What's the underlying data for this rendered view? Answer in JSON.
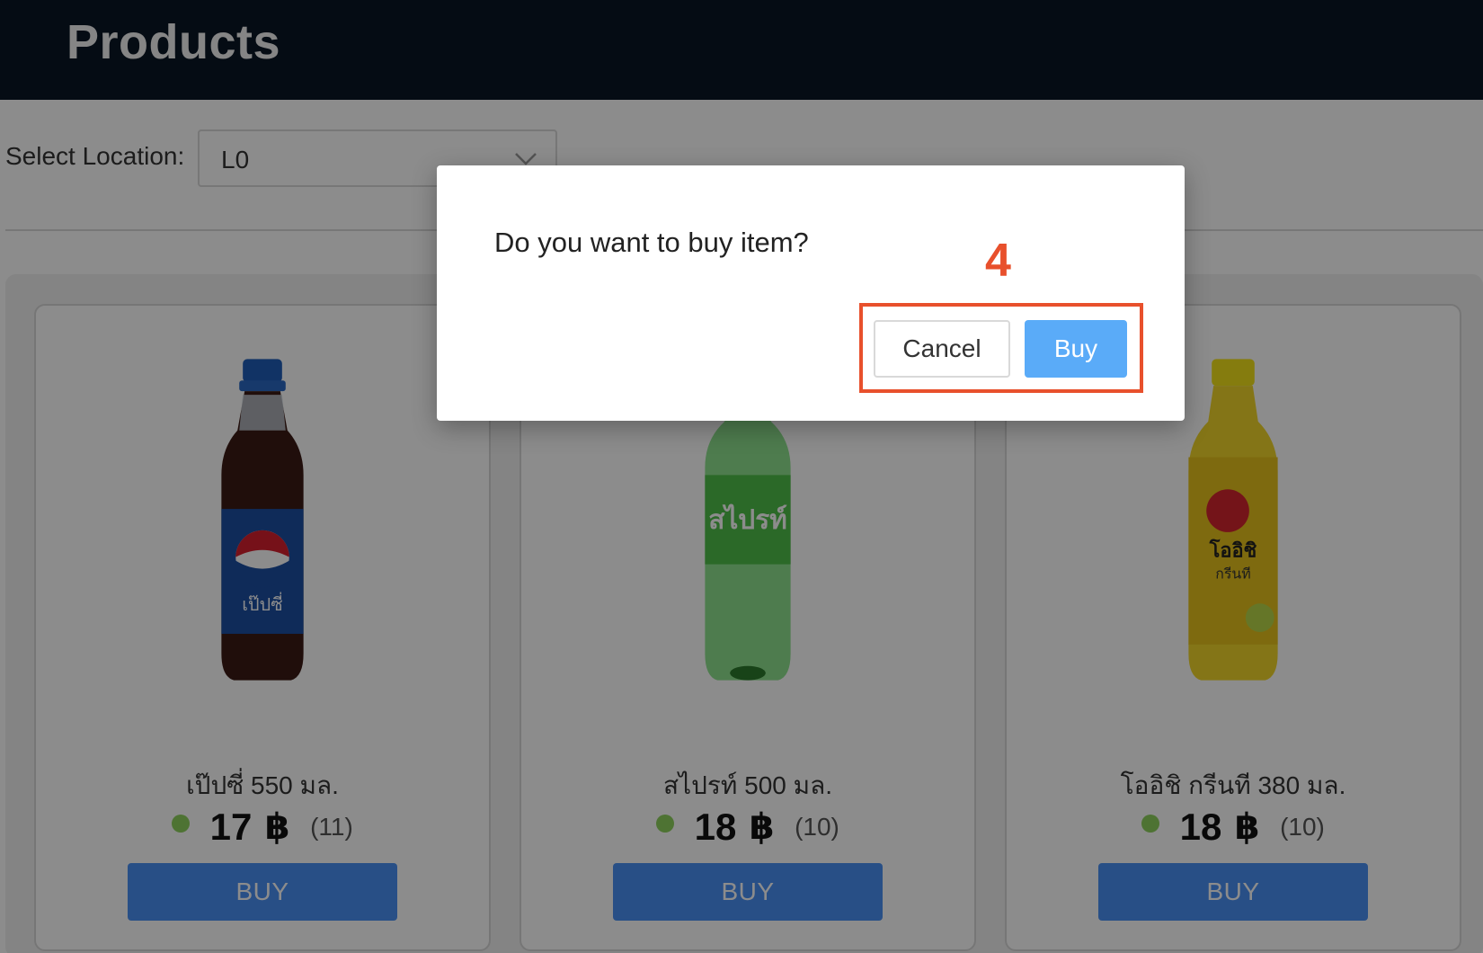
{
  "header": {
    "title": "Products"
  },
  "location": {
    "label": "Select Location:",
    "value": "L0"
  },
  "products": [
    {
      "name": "เป๊ปซี่ 550 มล.",
      "price": "17",
      "currency": "฿",
      "stock": "(11)",
      "buy_label": "BUY",
      "icon": "pepsi-bottle-image",
      "status_color": "#8fd15e"
    },
    {
      "name": "สไปรท์ 500 มล.",
      "price": "18",
      "currency": "฿",
      "stock": "(10)",
      "buy_label": "BUY",
      "icon": "sprite-bottle-image",
      "status_color": "#8fd15e"
    },
    {
      "name": "โออิชิ กรีนที 380 มล.",
      "price": "18",
      "currency": "฿",
      "stock": "(10)",
      "buy_label": "BUY",
      "icon": "oishi-greentea-bottle-image",
      "status_color": "#8fd15e"
    }
  ],
  "modal": {
    "message": "Do you want to buy item?",
    "cancel_label": "Cancel",
    "confirm_label": "Buy"
  },
  "annotation": {
    "step": "4",
    "color": "#e8502c"
  },
  "colors": {
    "header_bg": "#0a1726",
    "buy_button": "#4a90f5",
    "modal_confirm": "#5aabf8"
  }
}
